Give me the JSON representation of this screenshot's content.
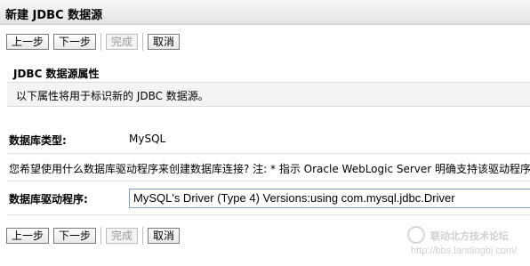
{
  "window": {
    "title": "新建 JDBC 数据源"
  },
  "buttons": {
    "back": "上一步",
    "next": "下一步",
    "finish": "完成",
    "cancel": "取消"
  },
  "section": {
    "title": "JDBC 数据源属性",
    "description": "以下属性将用于标识新的 JDBC 数据源。"
  },
  "fields": {
    "db_type_label": "数据库类型:",
    "db_type_value": "MySQL",
    "driver_question": "您希望使用什么数据库驱动程序来创建数据库连接? 注: * 指示 Oracle WebLogic Server 明确支持该驱动程序。",
    "driver_label": "数据库驱动程序:",
    "driver_value": "MySQL's Driver (Type 4) Versions:using com.mysql.jdbc.Driver"
  },
  "watermark": {
    "name": "联动北方技术论坛",
    "url": "http://bbs.landingbj.com/"
  }
}
